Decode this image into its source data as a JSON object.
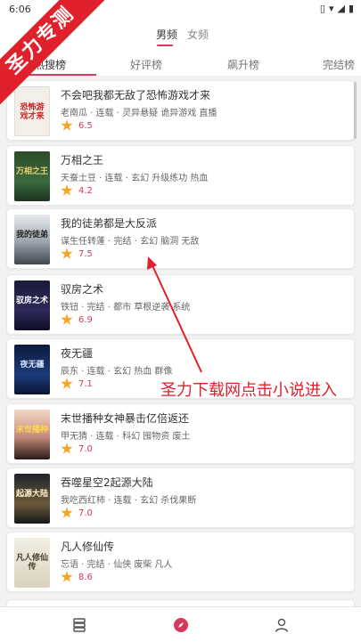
{
  "status_bar": {
    "time": "6:06",
    "icons": [
      "vibrate-icon",
      "wifi-icon",
      "signal-icon",
      "battery-icon"
    ]
  },
  "watermark": {
    "text": "圣力专测"
  },
  "gender_tabs": [
    {
      "label": "男频",
      "active": true
    },
    {
      "label": "女频",
      "active": false
    }
  ],
  "rank_tabs": [
    {
      "label": "热搜榜",
      "active": true
    },
    {
      "label": "好评榜",
      "active": false
    },
    {
      "label": "飙升榜",
      "active": false
    },
    {
      "label": "完结榜",
      "active": false
    }
  ],
  "books": [
    {
      "title": "不会吧我都无敌了恐怖游戏才来",
      "meta": "老南瓜 · 连载 · 灵异悬疑 诡异游戏 直播",
      "score": "6.5",
      "cover_text": "恐怖游戏才来"
    },
    {
      "title": "万相之王",
      "meta": "天蚕土豆 · 连载 · 玄幻 升级练功 热血",
      "score": "4.2",
      "cover_text": "万相之王"
    },
    {
      "title": "我的徒弟都是大反派",
      "meta": "谋生任转蓬 · 完结 · 玄幻 脑洞 无敌",
      "score": "7.5",
      "cover_text": "我的徒弟"
    },
    {
      "title": "驭房之术",
      "meta": "铁钮 · 完结 · 都市 草根逆袭 系统",
      "score": "6.9",
      "cover_text": "驭房之术"
    },
    {
      "title": "夜无疆",
      "meta": "辰东 · 连载 · 玄幻 热血 群像",
      "score": "7.1",
      "cover_text": "夜无疆"
    },
    {
      "title": "末世播种女神暴击亿倍返还",
      "meta": "甲无猜 · 连载 · 科幻 囤物资 废土",
      "score": "7.0",
      "cover_text": "末世播种"
    },
    {
      "title": "吞噬星空2起源大陆",
      "meta": "我吃西红柿 · 连载 · 玄幻 杀伐果断",
      "score": "7.0",
      "cover_text": "起源大陆"
    },
    {
      "title": "凡人修仙传",
      "meta": "忘语 · 完结 · 仙侠 废柴 凡人",
      "score": "8.6",
      "cover_text": "凡人修仙传"
    }
  ],
  "annotation": {
    "text": "圣力下载网点击小说进入"
  },
  "bottom_nav": [
    {
      "name": "bookshelf-icon",
      "active": false
    },
    {
      "name": "compass-icon",
      "active": true
    },
    {
      "name": "person-icon",
      "active": false
    }
  ],
  "colors": {
    "accent": "#d7385e",
    "star": "#f5a623",
    "annotation": "#e0202a"
  }
}
